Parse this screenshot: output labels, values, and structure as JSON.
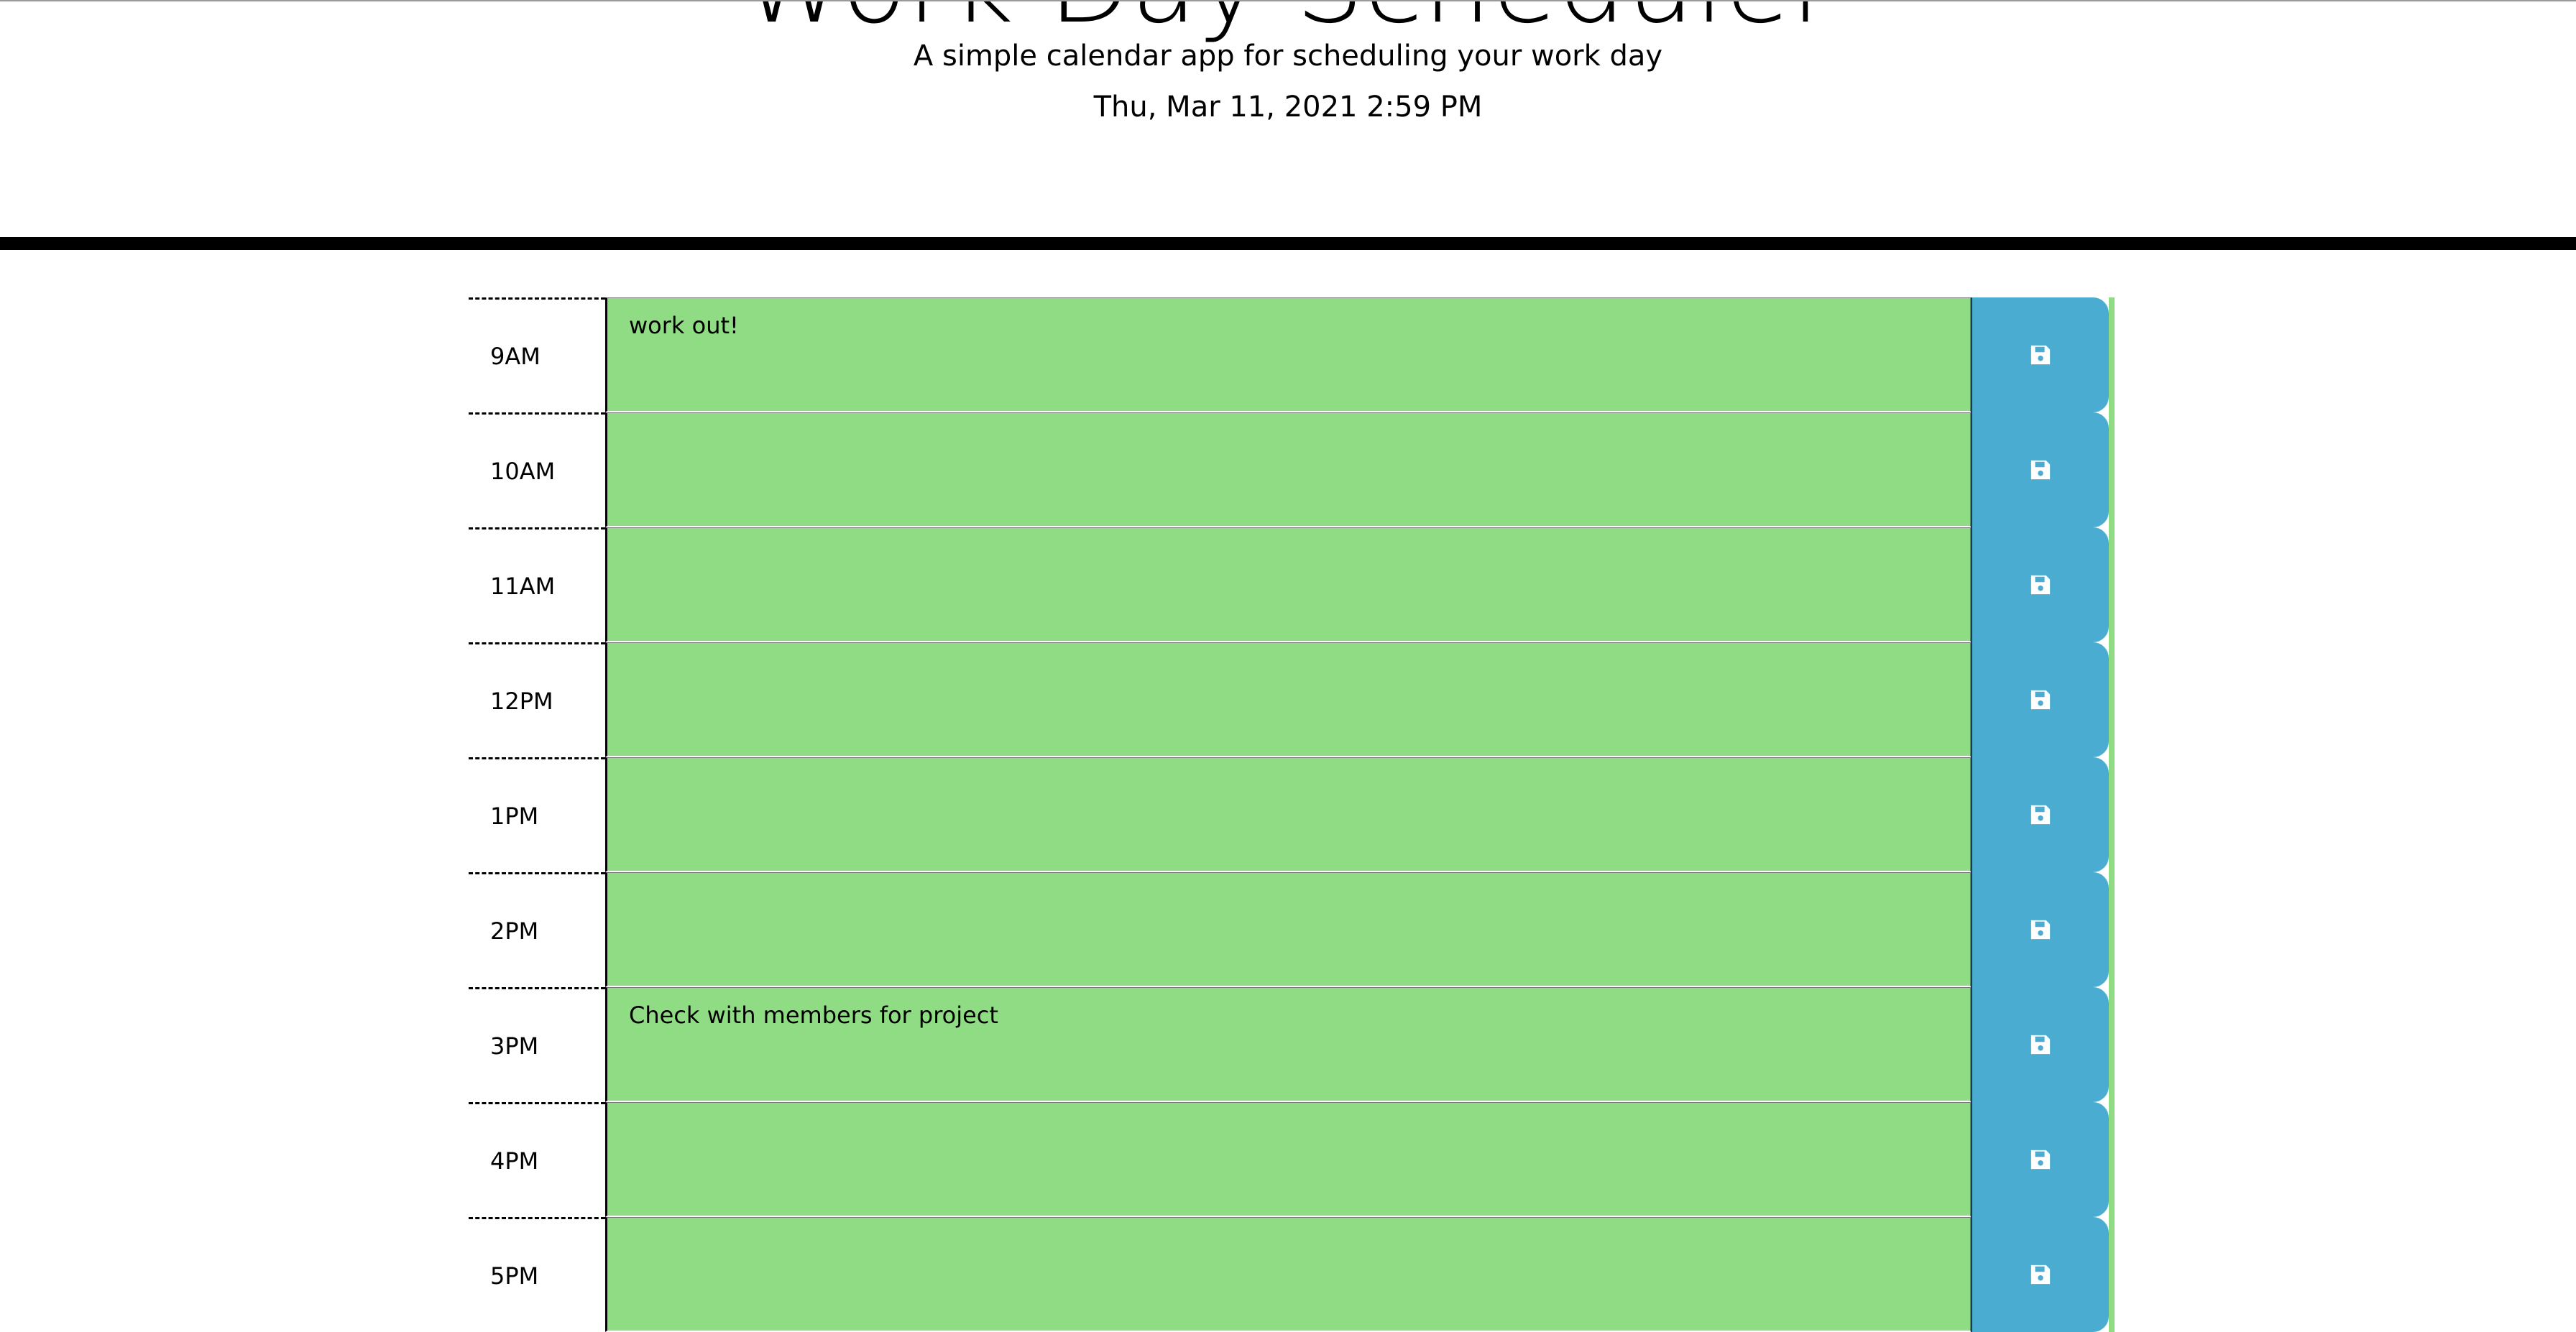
{
  "header": {
    "title": "Work Day Scheduler",
    "subtitle": "A simple calendar app for scheduling your work day",
    "current_day": "Thu, Mar 11, 2021 2:59 PM"
  },
  "colors": {
    "present_block": "#90dc84",
    "save_button": "#4bacd1",
    "divider": "#000000"
  },
  "schedule": {
    "blocks": [
      {
        "hour": "9AM",
        "text": "work out!",
        "save_icon": "floppy-disk-icon"
      },
      {
        "hour": "10AM",
        "text": "",
        "save_icon": "floppy-disk-icon"
      },
      {
        "hour": "11AM",
        "text": "",
        "save_icon": "floppy-disk-icon"
      },
      {
        "hour": "12PM",
        "text": "",
        "save_icon": "floppy-disk-icon"
      },
      {
        "hour": "1PM",
        "text": "",
        "save_icon": "floppy-disk-icon"
      },
      {
        "hour": "2PM",
        "text": "",
        "save_icon": "floppy-disk-icon"
      },
      {
        "hour": "3PM",
        "text": "Check with members for project",
        "save_icon": "floppy-disk-icon"
      },
      {
        "hour": "4PM",
        "text": "",
        "save_icon": "floppy-disk-icon"
      },
      {
        "hour": "5PM",
        "text": "",
        "save_icon": "floppy-disk-icon"
      }
    ]
  }
}
